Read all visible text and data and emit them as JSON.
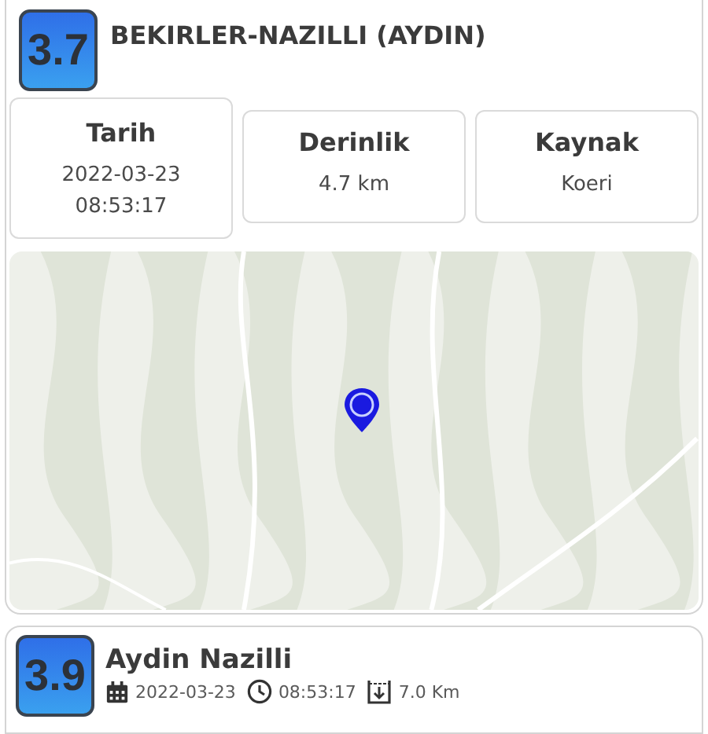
{
  "main_event": {
    "magnitude": "3.7",
    "location": "BEKIRLER-NAZILLI (AYDIN)",
    "info": [
      {
        "label": "Tarih",
        "value": "2022-03-23\n08:53:17"
      },
      {
        "label": "Derinlik",
        "value": "4.7 km"
      },
      {
        "label": "Kaynak",
        "value": "Koeri"
      }
    ]
  },
  "events": [
    {
      "magnitude": "3.9",
      "location": "Aydin Nazilli",
      "date": "2022-03-23",
      "time": "08:53:17",
      "depth": "7.0 Km"
    }
  ]
}
